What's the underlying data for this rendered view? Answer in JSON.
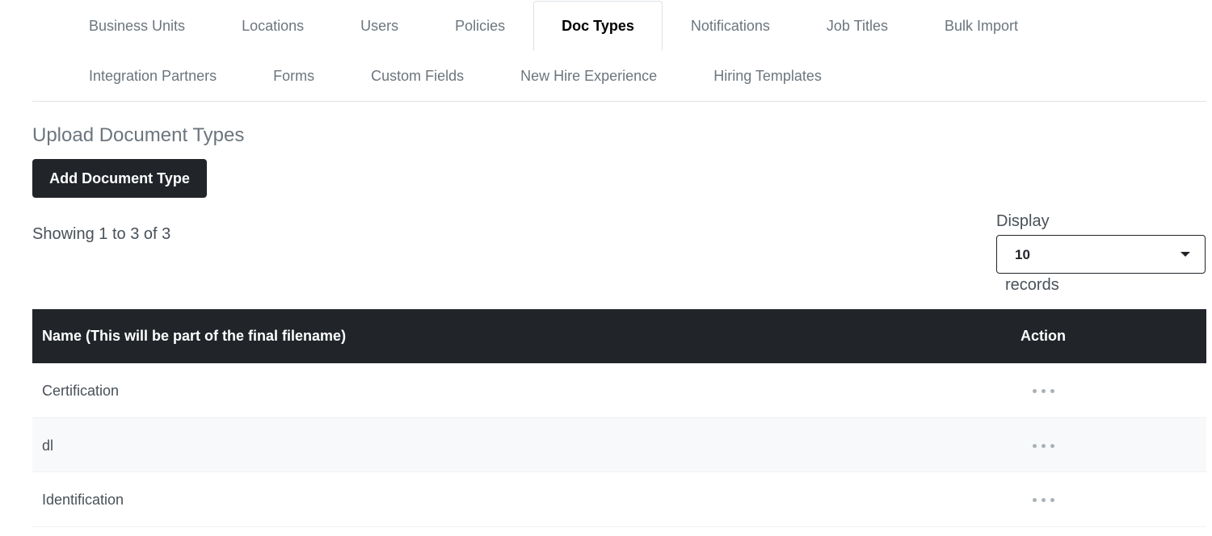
{
  "tabs": {
    "row1": [
      "Business Units",
      "Locations",
      "Users",
      "Policies",
      "Doc Types",
      "Notifications",
      "Job Titles",
      "Bulk Import"
    ],
    "row2": [
      "Integration Partners",
      "Forms",
      "Custom Fields",
      "New Hire Experience",
      "Hiring Templates"
    ],
    "active": "Doc Types"
  },
  "section": {
    "title": "Upload Document Types",
    "add_button": "Add Document Type"
  },
  "pagination": {
    "showing": "Showing 1 to 3 of 3",
    "display_label": "Display",
    "records_value": "10",
    "records_label": "records"
  },
  "table": {
    "headers": {
      "name": "Name (This will be part of the final filename)",
      "action": "Action"
    },
    "rows": [
      {
        "name": "Certification"
      },
      {
        "name": "dl"
      },
      {
        "name": "Identification"
      }
    ]
  },
  "colors": {
    "dark": "#212529",
    "muted_text": "#6c757d",
    "stripe": "#f8f9fa"
  }
}
